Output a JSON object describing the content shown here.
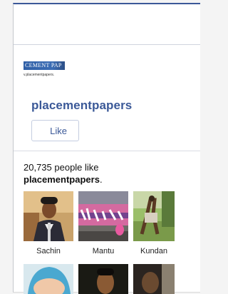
{
  "page": {
    "logo_text": "CEMENT PAP",
    "logo_sub": "v.placementpapers.",
    "name": "placementpapers",
    "like_button": "Like"
  },
  "stats": {
    "count_text": "20,735 people like",
    "page_name": "placementpapers",
    "suffix": "."
  },
  "fans": [
    {
      "name": "Sachin"
    },
    {
      "name": "Mantu"
    },
    {
      "name": "Kundan"
    }
  ],
  "colors": {
    "brand": "#3b5998"
  }
}
